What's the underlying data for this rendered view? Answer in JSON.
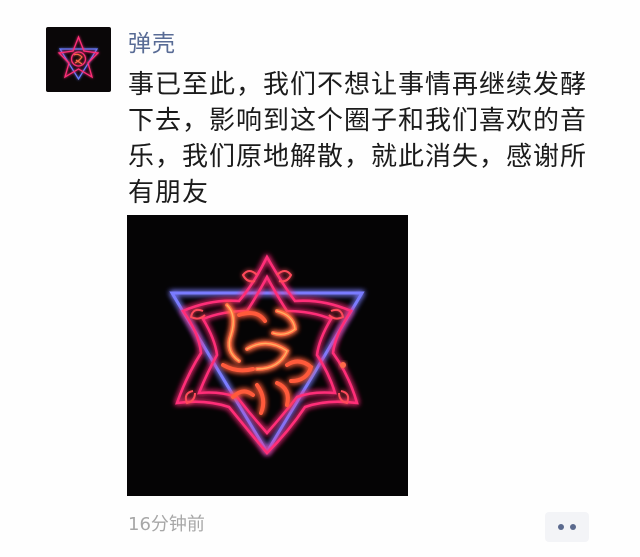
{
  "post": {
    "author_name": "弹壳",
    "text": "事已至此，我们不想让事情再继续发酵下去，影响到这个圈子和我们喜欢的音乐，我们原地解散，就此消失，感谢所有朋友",
    "timestamp": "16分钟前",
    "avatar_icon": "neon-flower-logo",
    "photo_icon": "neon-flower-triangle-logo"
  },
  "colors": {
    "author_name": "#586b95",
    "text": "#1b1b1b",
    "timestamp": "#a7a7a7",
    "neon_pink": "#ff2d78",
    "neon_red": "#ff3b3b",
    "neon_blue": "#6a7bff"
  }
}
